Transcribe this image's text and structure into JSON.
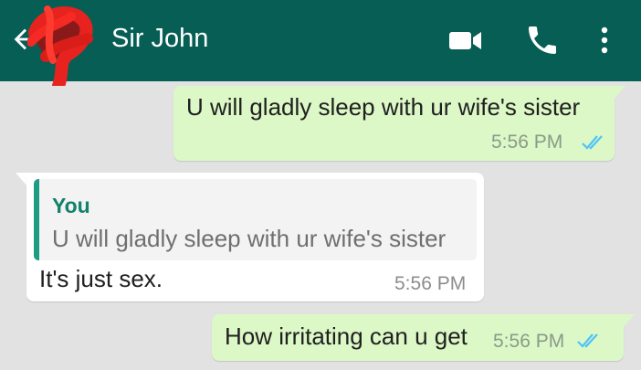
{
  "header": {
    "contact_name": "Sir John",
    "back_icon": "arrow-left-icon",
    "avatar_icon": "avatar",
    "video_icon": "video-camera-icon",
    "call_icon": "phone-icon",
    "menu_icon": "more-vertical-icon",
    "bg_color": "#075e54"
  },
  "messages": [
    {
      "direction": "outgoing",
      "text": "U will gladly sleep with ur wife's sister",
      "time": "5:56 PM",
      "status": "read",
      "ticks_icon": "double-check-icon"
    },
    {
      "direction": "incoming",
      "quote": {
        "author": "You",
        "text": "U will gladly sleep with ur wife's sister"
      },
      "text": "It's just sex.",
      "time": "5:56 PM"
    },
    {
      "direction": "outgoing",
      "text": "How irritating can u get",
      "time": "5:56 PM",
      "status": "read",
      "ticks_icon": "double-check-icon"
    }
  ],
  "colors": {
    "outgoing_bubble": "#dcf8c6",
    "incoming_bubble": "#ffffff",
    "read_ticks": "#4fc3f7",
    "quote_accent": "#1e9d85"
  }
}
